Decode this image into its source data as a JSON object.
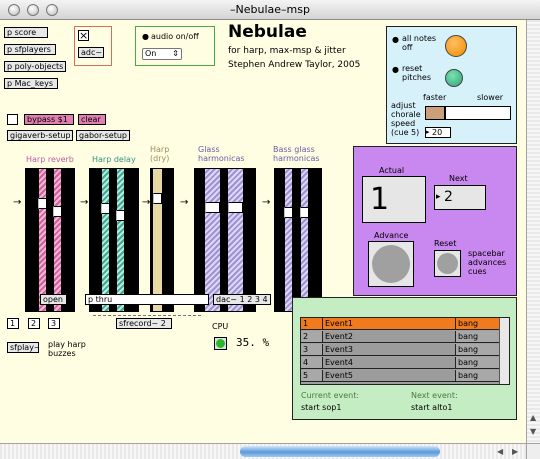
{
  "window": {
    "title": "–Nebulae–msp"
  },
  "subpatchers": [
    "p score",
    "p sfplayers",
    "p poly-objects",
    "p Mac_keys"
  ],
  "adc_label": "adc~",
  "audio": {
    "toggle_label": "audio on/off",
    "menu_value": "On"
  },
  "header": {
    "title": "Nebulae",
    "subtitle": "for harp, max-msp & jitter",
    "author": "Stephen Andrew Taylor, 2005"
  },
  "controls": {
    "all_notes_off": "all notes off",
    "reset_pitches": "reset pitches",
    "faster": "faster",
    "slower": "slower",
    "adjust_label": "adjust chorale speed (cue 5)",
    "speed_value": "20"
  },
  "reverb_msgs": {
    "bypass": "bypass $1",
    "clear": "clear",
    "gigaverb": "gigaverb-setup",
    "gabor": "gabor-setup"
  },
  "mixer": {
    "labels": [
      "Harp reverb",
      "Harp delay",
      "Harp (dry)",
      "Glass harmonicas",
      "Bass glass harmonicas"
    ],
    "colors": [
      "#b85da3",
      "#2f9484",
      "#8a7d52",
      "#6a5aa8",
      "#6a5aa8"
    ]
  },
  "event_panel": {
    "actual_label": "Actual",
    "actual_value": "1",
    "next_label": "Next",
    "next_value": "2",
    "advance_label": "Advance",
    "reset_label": "Reset",
    "spacebar_note": "spacebar advances cues"
  },
  "routing": {
    "open": "open",
    "pthru": "p thru",
    "dac": "dac~ 1 2 3 4",
    "sfrecord": "sfrecord~ 2"
  },
  "sfplay": {
    "numbers": [
      "1",
      "2",
      "3"
    ],
    "label": "sfplay~",
    "note": "play harp buzzes"
  },
  "cpu": {
    "label": "CPU",
    "value": "35. %"
  },
  "event_table": {
    "rows": [
      [
        "1",
        "Event1",
        "bang"
      ],
      [
        "2",
        "Event2",
        "bang"
      ],
      [
        "3",
        "Event3",
        "bang"
      ],
      [
        "4",
        "Event4",
        "bang"
      ],
      [
        "5",
        "Event5",
        "bang"
      ]
    ],
    "current_label": "Current event:",
    "current_value": "start sop1",
    "next_label": "Next event:",
    "next_value": "start alto1"
  }
}
